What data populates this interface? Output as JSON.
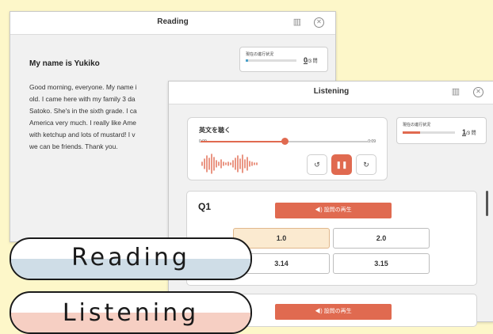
{
  "reading_window": {
    "title": "Reading",
    "progress": {
      "label": "現在の進行状況",
      "current": "0",
      "total": "/3 問",
      "fraction": 0.0
    },
    "passage_title": "My name is Yukiko",
    "passage": [
      "Good morning, everyone. My name i",
      "old. I came here with my family 3 da",
      "Satoko. She's in the sixth grade. I ca",
      "America very much. I really like Ame",
      "with ketchup and lots of mustard! I v",
      "we can be friends. Thank you."
    ]
  },
  "listening_window": {
    "title": "Listening",
    "progress": {
      "label": "現在の進行状況",
      "current": "1",
      "total": "/3 問",
      "fraction": 0.333
    },
    "audio": {
      "heading": "英文を聴く",
      "time_current": "0:09",
      "time_total": "0:09",
      "position": 0.5
    },
    "questions": [
      {
        "number": "Q1",
        "play_label": "設問の再生",
        "options": [
          "1.0",
          "2.0",
          "3.14",
          "3.15"
        ],
        "selected": 0
      },
      {
        "number": "",
        "play_label": "設問の再生",
        "options": []
      }
    ]
  },
  "labels": {
    "reading": "Reading",
    "listening": "Listening"
  },
  "colors": {
    "accent": "#e06a50",
    "background": "#fdf7c9",
    "reading_band": "#cfdde7",
    "listening_band": "#f6cfc3"
  }
}
